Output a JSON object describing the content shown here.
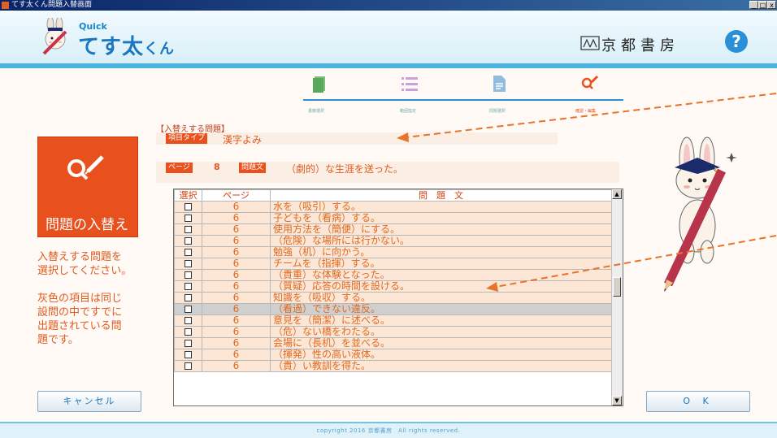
{
  "window": {
    "title": "てす太くん問題入替画面",
    "min": "_",
    "max": "□",
    "close": "x"
  },
  "header": {
    "logo_quick": "Quick",
    "logo_main": "てす太",
    "logo_sub": "くん",
    "publisher": "京都書房",
    "help": "?"
  },
  "steps": [
    {
      "label": "書籍選択",
      "icon": "book-icon"
    },
    {
      "label": "範囲指定",
      "icon": "list-icon"
    },
    {
      "label": "問題選択",
      "icon": "document-icon"
    },
    {
      "label": "確認・編集",
      "icon": "search-edit-icon"
    }
  ],
  "left_panel": {
    "action_label": "問題の入替え",
    "instruction1_line1": "入替えする問題を",
    "instruction1_line2": "選択してください。",
    "instruction2_line1": "灰色の項目は同じ",
    "instruction2_line2": "設問の中ですでに",
    "instruction2_line3": "出題されている問",
    "instruction2_line4": "題です。"
  },
  "main": {
    "section_heading": "【入替えする問題】",
    "type_tag": "項目タイプ",
    "type_value": "漢字よみ",
    "page_tag": "ページ",
    "page_value": "8",
    "sentence_tag": "問題文",
    "sentence_value": "（劇的）な生涯を送った。"
  },
  "table": {
    "headers": {
      "select": "選択",
      "page": "ページ",
      "question": "問　題　文"
    },
    "rows": [
      {
        "page": "6",
        "question": "水を（吸引）する。",
        "grey": false
      },
      {
        "page": "6",
        "question": "子どもを（看病）する。",
        "grey": false
      },
      {
        "page": "6",
        "question": "使用方法を（簡便）にする。",
        "grey": false
      },
      {
        "page": "6",
        "question": "（危険）な場所には行かない。",
        "grey": false
      },
      {
        "page": "6",
        "question": "勉強（机）に向かう。",
        "grey": false
      },
      {
        "page": "6",
        "question": "チームを（指揮）する。",
        "grey": false
      },
      {
        "page": "6",
        "question": "（貴重）な体験となった。",
        "grey": false
      },
      {
        "page": "6",
        "question": "（質疑）応答の時間を設ける。",
        "grey": false
      },
      {
        "page": "6",
        "question": "知識を（吸収）する。",
        "grey": false
      },
      {
        "page": "6",
        "question": "（看過）できない違反。",
        "grey": true
      },
      {
        "page": "6",
        "question": "意見を（簡潔）に述べる。",
        "grey": false
      },
      {
        "page": "6",
        "question": "（危）ない橋をわたる。",
        "grey": false
      },
      {
        "page": "6",
        "question": "会場に（長机）を並べる。",
        "grey": false
      },
      {
        "page": "6",
        "question": "（揮発）性の高い液体。",
        "grey": false
      },
      {
        "page": "6",
        "question": "（貴）い教訓を得た。",
        "grey": false
      }
    ]
  },
  "buttons": {
    "cancel": "キャンセル",
    "ok": "O K"
  },
  "footer": {
    "copyright": "copyright 2016 京都書房　All rights reserved."
  },
  "colors": {
    "accent": "#e8501e",
    "brand_blue": "#1a76c0",
    "header_band": "#4ab3e0",
    "grey_row": "#cfcfcf"
  }
}
